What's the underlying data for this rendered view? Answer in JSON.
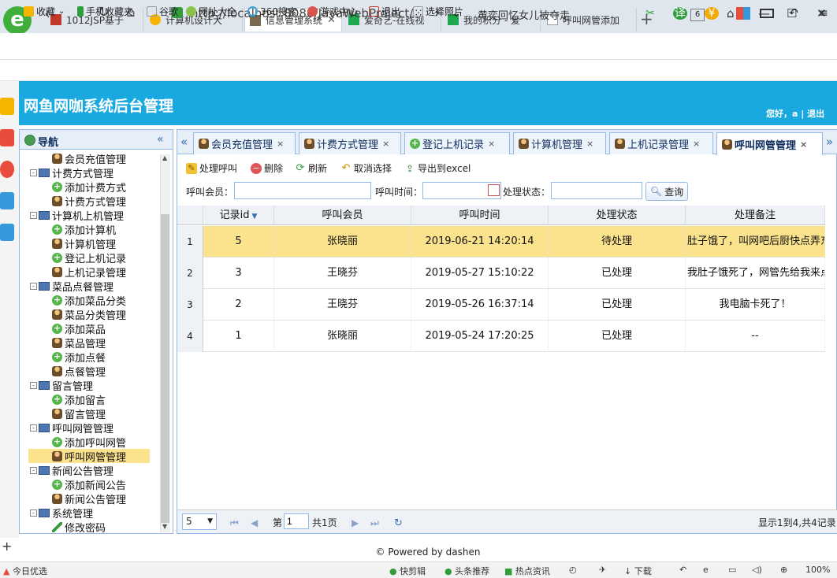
{
  "browser": {
    "tabs": [
      {
        "label": "1012JSP基于"
      },
      {
        "label": "计算机设计大"
      },
      {
        "label": "信息管理系统"
      },
      {
        "label": "爱奇艺-在线视"
      },
      {
        "label": "我的积分 - 爱"
      },
      {
        "label": "呼叫网管添加"
      }
    ],
    "tab_count": "6",
    "url": "http://localhost:8080/JavaWebProject/",
    "search_hint": "黄奕回忆女儿被夺走",
    "bookmarks": [
      "收藏",
      "手机收藏夹",
      "谷歌",
      "网址大全",
      "360搜索",
      "游戏中心",
      "退出",
      "选择照片"
    ]
  },
  "app": {
    "title": "网鱼网咖系统后台管理",
    "greeting": "您好，a | 退出"
  },
  "nav": {
    "title": "导航",
    "items": [
      {
        "label": "会员充值管理"
      },
      {
        "label": "计费方式管理"
      },
      {
        "label": "添加计费方式"
      },
      {
        "label": "计费方式管理"
      },
      {
        "label": "计算机上机管理"
      },
      {
        "label": "添加计算机"
      },
      {
        "label": "计算机管理"
      },
      {
        "label": "登记上机记录"
      },
      {
        "label": "上机记录管理"
      },
      {
        "label": "菜品点餐管理"
      },
      {
        "label": "添加菜品分类"
      },
      {
        "label": "菜品分类管理"
      },
      {
        "label": "添加菜品"
      },
      {
        "label": "菜品管理"
      },
      {
        "label": "添加点餐"
      },
      {
        "label": "点餐管理"
      },
      {
        "label": "留言管理"
      },
      {
        "label": "添加留言"
      },
      {
        "label": "留言管理"
      },
      {
        "label": "呼叫网管管理"
      },
      {
        "label": "添加呼叫网管"
      },
      {
        "label": "呼叫网管管理"
      },
      {
        "label": "新闻公告管理"
      },
      {
        "label": "添加新闻公告"
      },
      {
        "label": "新闻公告管理"
      },
      {
        "label": "系统管理"
      },
      {
        "label": "修改密码"
      }
    ]
  },
  "tabs": [
    {
      "label": "会员充值管理"
    },
    {
      "label": "计费方式管理"
    },
    {
      "label": "登记上机记录"
    },
    {
      "label": "计算机管理"
    },
    {
      "label": "上机记录管理"
    },
    {
      "label": "呼叫网管管理"
    }
  ],
  "toolbar": {
    "process": "处理呼叫",
    "delete": "删除",
    "refresh": "刷新",
    "unselect": "取消选择",
    "export": "导出到excel"
  },
  "filters": {
    "member_label": "呼叫会员：",
    "time_label": "呼叫时间：",
    "status_label": "处理状态：",
    "search": "查询"
  },
  "grid": {
    "columns": [
      "记录id",
      "呼叫会员",
      "呼叫时间",
      "处理状态",
      "处理备注"
    ],
    "rows": [
      {
        "rownum": "1",
        "id": "5",
        "member": "张晓丽",
        "time": "2019-06-21 14:20:14",
        "status": "待处理",
        "note": "肚子饿了，叫网吧后厨快点弄东"
      },
      {
        "rownum": "2",
        "id": "3",
        "member": "王晓芬",
        "time": "2019-05-27 15:10:22",
        "status": "已处理",
        "note": "我肚子饿死了，网管先给我来点"
      },
      {
        "rownum": "3",
        "id": "2",
        "member": "王晓芬",
        "time": "2019-05-26 16:37:14",
        "status": "已处理",
        "note": "我电脑卡死了！"
      },
      {
        "rownum": "4",
        "id": "1",
        "member": "张晓丽",
        "time": "2019-05-24 17:20:25",
        "status": "已处理",
        "note": "--"
      }
    ]
  },
  "pager": {
    "page_size": "5",
    "page_prefix": "第",
    "page_value": "1",
    "page_total": "共1页",
    "summary": "显示1到4,共4记录"
  },
  "footer": "© Powered by dashen",
  "statusbar": {
    "left": "今日优选",
    "items": [
      "快剪辑",
      "头条推荐",
      "热点资讯",
      "下载",
      "100%"
    ]
  }
}
